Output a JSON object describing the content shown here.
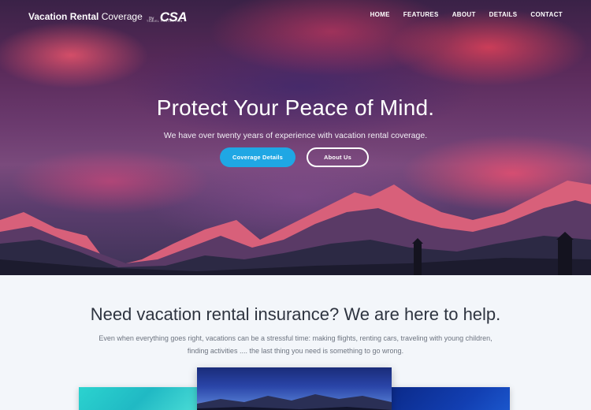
{
  "brand": {
    "name_bold": "Vacation Rental",
    "name_regular": "Coverage",
    "by": "by",
    "logo": "CSA",
    "logo_sub": "TRAVEL PROTECTION"
  },
  "nav": {
    "items": [
      {
        "label": "HOME"
      },
      {
        "label": "FEATURES"
      },
      {
        "label": "ABOUT"
      },
      {
        "label": "DETAILS"
      },
      {
        "label": "CONTACT"
      }
    ]
  },
  "hero": {
    "title": "Protect Your Peace of Mind.",
    "subtitle": "We have over twenty years of experience with vacation rental coverage.",
    "primary_button": "Coverage Details",
    "secondary_button": "About Us"
  },
  "intro": {
    "title": "Need vacation rental insurance? We are here to help.",
    "text": "Even when everything goes right, vacations can be a stressful time: making flights, renting cars, traveling with young children, finding activities .... the last thing you need is something to go wrong."
  },
  "colors": {
    "accent": "#1fa7e4",
    "heading": "#2e3440",
    "body_text": "#6d7480",
    "background": "#f3f6fa"
  }
}
